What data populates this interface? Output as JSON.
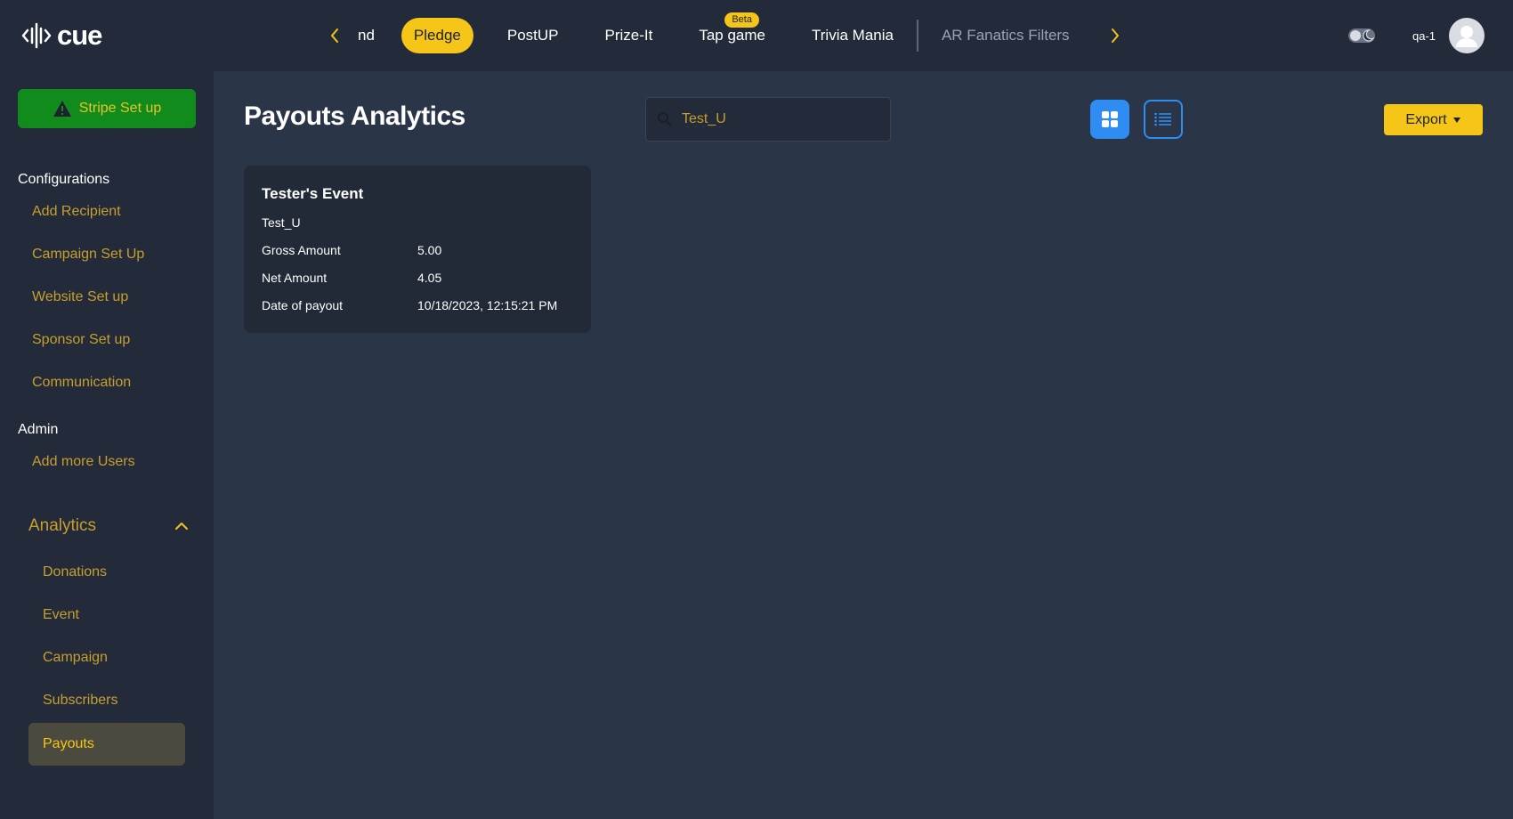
{
  "app": {
    "logo_text": "cue"
  },
  "nav": {
    "tabs": [
      {
        "label": "nd"
      },
      {
        "label": "Pledge"
      },
      {
        "label": "PostUP"
      },
      {
        "label": "Prize-It"
      },
      {
        "label": "Tap game",
        "badge": "Beta"
      },
      {
        "label": "Trivia Mania"
      },
      {
        "label": "AR Fanatics Filters"
      }
    ]
  },
  "user": {
    "name": "qa-1"
  },
  "sidebar": {
    "stripe_label": "Stripe Set up",
    "configurations_title": "Configurations",
    "config_items": [
      "Add Recipient",
      "Campaign Set Up",
      "Website Set up",
      "Sponsor Set up",
      "Communication"
    ],
    "admin_title": "Admin",
    "admin_items": [
      "Add more Users"
    ],
    "analytics_title": "Analytics",
    "analytics_items": [
      "Donations",
      "Event",
      "Campaign",
      "Subscribers",
      "Payouts"
    ]
  },
  "main": {
    "title": "Payouts Analytics",
    "search_value": "Test_U",
    "export_label": "Export"
  },
  "card": {
    "title": "Tester's Event",
    "subtitle": "Test_U",
    "rows": [
      {
        "key": "Gross Amount",
        "value": "5.00"
      },
      {
        "key": "Net Amount",
        "value": "4.05"
      },
      {
        "key": "Date of payout",
        "value": "10/18/2023, 12:15:21 PM"
      }
    ]
  },
  "colors": {
    "accent": "#f5c518",
    "link": "#c79f2d",
    "primary_blue": "#2f8cf2",
    "stripe_green": "#118c1c",
    "background": "#2b3548",
    "panel": "#232b3a"
  }
}
